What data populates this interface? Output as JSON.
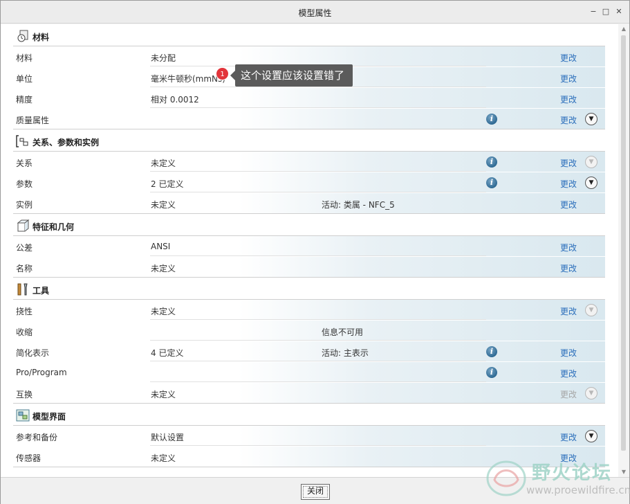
{
  "window": {
    "title": "模型属性"
  },
  "link_label": "更改",
  "tooltip": {
    "badge": "1",
    "text": "这个设置应该设置错了"
  },
  "sections": [
    {
      "title": "材料",
      "icon": "material-icon",
      "rows": [
        {
          "label": "材料",
          "value": "未分配",
          "extra": "",
          "info": false,
          "link_disabled": false,
          "chevron": "none"
        },
        {
          "label": "单位",
          "value": "毫米牛顿秒(mmNs)",
          "extra": "",
          "info": false,
          "link_disabled": false,
          "chevron": "none"
        },
        {
          "label": "精度",
          "value": "相对 0.0012",
          "extra": "",
          "info": false,
          "link_disabled": false,
          "chevron": "none"
        },
        {
          "label": "质量属性",
          "value": "",
          "extra": "",
          "info": true,
          "link_disabled": false,
          "chevron": "active"
        }
      ]
    },
    {
      "title": "关系、参数和实例",
      "icon": "relations-icon",
      "rows": [
        {
          "label": "关系",
          "value": "未定义",
          "extra": "",
          "info": true,
          "link_disabled": false,
          "chevron": "dim"
        },
        {
          "label": "参数",
          "value": "2 已定义",
          "extra": "",
          "info": true,
          "link_disabled": false,
          "chevron": "active"
        },
        {
          "label": "实例",
          "value": "未定义",
          "extra": "活动: 类属 - NFC_5",
          "info": false,
          "link_disabled": false,
          "chevron": "none"
        }
      ]
    },
    {
      "title": "特征和几何",
      "icon": "feature-geometry-icon",
      "rows": [
        {
          "label": "公差",
          "value": "ANSI",
          "extra": "",
          "info": false,
          "link_disabled": false,
          "chevron": "none"
        },
        {
          "label": "名称",
          "value": "未定义",
          "extra": "",
          "info": false,
          "link_disabled": false,
          "chevron": "none"
        }
      ]
    },
    {
      "title": "工具",
      "icon": "tools-icon",
      "rows": [
        {
          "label": "挠性",
          "value": "未定义",
          "extra": "",
          "info": false,
          "link_disabled": false,
          "chevron": "dim"
        },
        {
          "label": "收缩",
          "value": "",
          "extra": "信息不可用",
          "info": false,
          "link_disabled": null,
          "chevron": "none"
        },
        {
          "label": "简化表示",
          "value": "4 已定义",
          "extra": "活动: 主表示",
          "info": true,
          "link_disabled": false,
          "chevron": "none"
        },
        {
          "label": "Pro/Program",
          "value": "",
          "extra": "",
          "info": true,
          "link_disabled": false,
          "chevron": "none"
        },
        {
          "label": "互换",
          "value": "未定义",
          "extra": "",
          "info": false,
          "link_disabled": true,
          "chevron": "dim"
        }
      ]
    },
    {
      "title": "模型界面",
      "icon": "model-interface-icon",
      "rows": [
        {
          "label": "参考和备份",
          "value": "默认设置",
          "extra": "",
          "info": false,
          "link_disabled": false,
          "chevron": "active"
        },
        {
          "label": "传感器",
          "value": "未定义",
          "extra": "",
          "info": false,
          "link_disabled": false,
          "chevron": "none"
        }
      ]
    }
  ],
  "footer": {
    "close_label": "关闭"
  },
  "watermark": {
    "text": "野火论坛",
    "url": "www.proewildfire.cn"
  }
}
